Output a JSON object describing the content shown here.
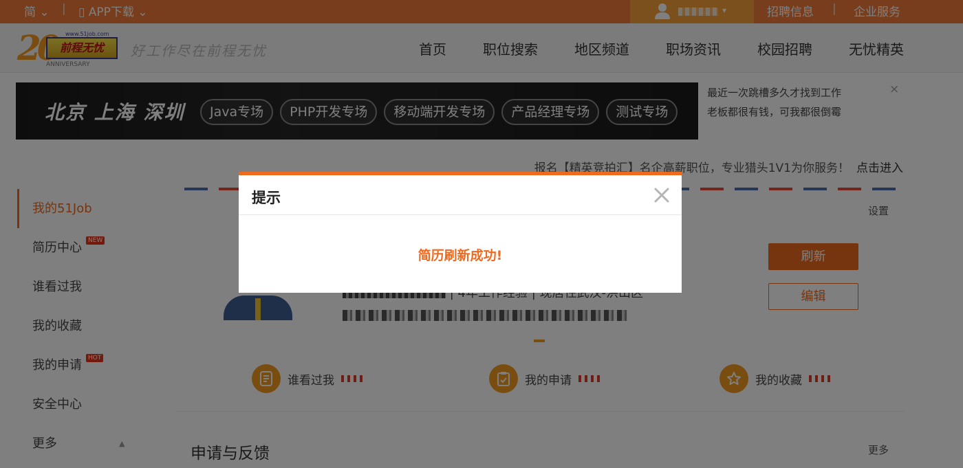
{
  "topbar": {
    "lang": "简 ⌄",
    "app_label": "APP下载 ⌄",
    "jobs": "招聘信息",
    "enterprise": "企业服务",
    "bg_color": "#ee7a38"
  },
  "header": {
    "logo_text": "前程无忧",
    "logo_url": "www.51job.com",
    "logo_anniversary": "ANNIVERSARY",
    "logo_number": "20",
    "slogan": "好工作尽在前程无忧",
    "nav": [
      "首页",
      "职位搜索",
      "地区频道",
      "职场资讯",
      "校园招聘",
      "无忧精英"
    ]
  },
  "banner": {
    "cities": "北京 上海 深圳",
    "tags": [
      "Java专场",
      "PHP开发专场",
      "移动端开发专场",
      "产品经理专场",
      "测试专场"
    ]
  },
  "side_note": {
    "line1": "最近一次跳槽多久才找到工作",
    "line2": "老板都很有钱，可我都很倒霉",
    "close": "×"
  },
  "promo": {
    "text": "报名【精英竞拍汇】名企高薪职位，专业猎头1V1为你服务！",
    "link": "点击进入"
  },
  "sidebar": {
    "items": [
      {
        "label": "我的51Job",
        "active": true
      },
      {
        "label": "简历中心",
        "badge": "NEW"
      },
      {
        "label": "谁看过我"
      },
      {
        "label": "我的收藏"
      },
      {
        "label": "我的申请",
        "badge": "HOT"
      },
      {
        "label": "安全中心"
      },
      {
        "label": "更多"
      }
    ]
  },
  "main": {
    "settings": "设置",
    "refresh_button": "刷新",
    "edit_button": "编辑",
    "profile_line": "| 4年工作经验 | 现居住武汉-洪山区",
    "stats": [
      {
        "label": "谁看过我",
        "icon": "document-icon"
      },
      {
        "label": "我的申请",
        "icon": "clipboard-check-icon"
      },
      {
        "label": "我的收藏",
        "icon": "star-icon"
      }
    ],
    "section_title": "申请与反馈",
    "section_more": "更多"
  },
  "modal": {
    "title": "提示",
    "message": "简历刷新成功!",
    "close": "×",
    "accent": "#ee6a1f"
  }
}
